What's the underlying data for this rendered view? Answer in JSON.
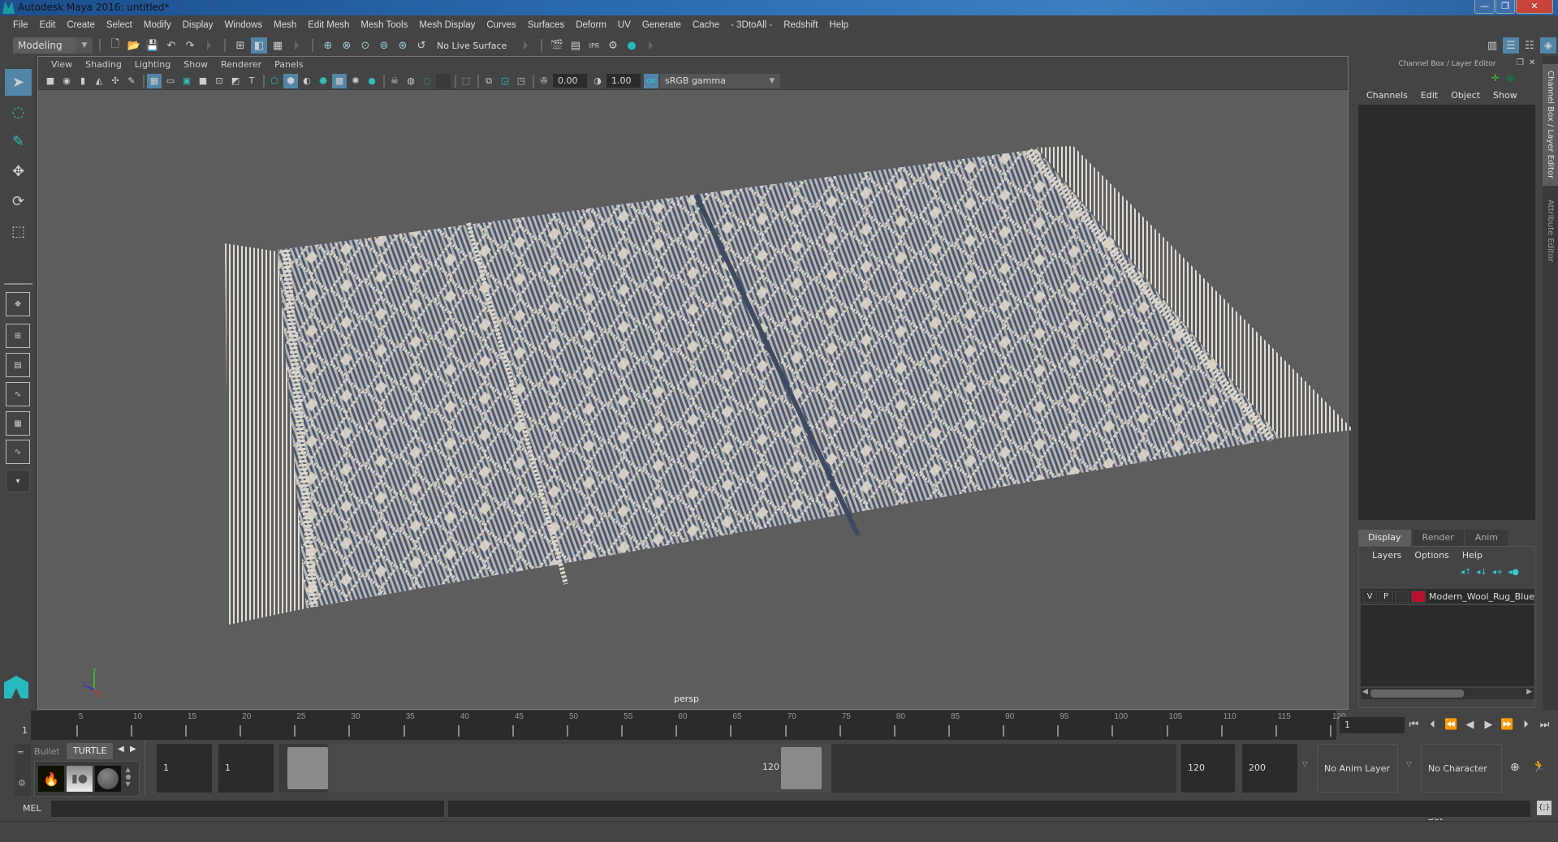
{
  "window": {
    "title": "Autodesk Maya 2016: untitled*",
    "controls": {
      "minimize": "—",
      "restore": "❐",
      "close": "✕"
    }
  },
  "menubar": [
    "File",
    "Edit",
    "Create",
    "Select",
    "Modify",
    "Display",
    "Windows",
    "Mesh",
    "Edit Mesh",
    "Mesh Tools",
    "Mesh Display",
    "Curves",
    "Surfaces",
    "Deform",
    "UV",
    "Generate",
    "Cache",
    "- 3DtoAll -",
    "Redshift",
    "Help"
  ],
  "statusline": {
    "menuset": "Modeling",
    "live_surface": "No Live Surface",
    "icons": [
      "new-scene-icon",
      "open-scene-icon",
      "save-scene-icon",
      "undo-icon",
      "redo-icon",
      "select-by-hierarchy-icon",
      "select-by-object-icon",
      "select-by-component-icon",
      "snap-grid-icon",
      "snap-curve-icon",
      "snap-point-icon",
      "snap-view-plane-icon",
      "snap-live-icon",
      "render-view-icon",
      "render-icon",
      "ipr-render-icon",
      "render-settings-icon",
      "hypershade-icon"
    ],
    "ipr_label": "IPR"
  },
  "viewport": {
    "menus": [
      "View",
      "Shading",
      "Lighting",
      "Show",
      "Renderer",
      "Panels"
    ],
    "exposure": "0.00",
    "gamma": "1.00",
    "color_mgmt_toggle": "ON",
    "view_transform": "sRGB gamma",
    "camera_label": "persp",
    "axis": {
      "x": "x",
      "y": "y",
      "z": "z"
    },
    "rug_colors": {
      "base": "#4a5870",
      "pattern": "#d9d2c6",
      "fringe": "#e2ddd4"
    }
  },
  "toolbox": {
    "tools": [
      "select-tool",
      "lasso-tool",
      "paint-select-tool",
      "move-tool",
      "rotate-tool",
      "scale-tool"
    ],
    "layouts": [
      "single-perspective-layout",
      "four-view-layout",
      "persp-outliner-layout",
      "persp-graph-layout",
      "persp-hypershade-layout",
      "persp-graph-outliner-layout"
    ],
    "more": "▾"
  },
  "right_panel": {
    "header": "Channel Box / Layer Editor",
    "channel_menus": [
      "Channels",
      "Edit",
      "Object",
      "Show"
    ],
    "layer_tabs": [
      "Display",
      "Render",
      "Anim"
    ],
    "active_layer_tab": "Display",
    "layer_menus": [
      "Layers",
      "Options",
      "Help"
    ],
    "layers": [
      {
        "visible": "V",
        "playback": "P",
        "name": "Modern_Wool_Rug_Blue",
        "color": "#b4122e"
      }
    ],
    "side_tabs": [
      "Channel Box / Layer Editor",
      "Attribute Editor"
    ]
  },
  "timeline": {
    "start": 1,
    "end": 120,
    "tick_labels": [
      "5",
      "10",
      "15",
      "20",
      "25",
      "30",
      "35",
      "40",
      "45",
      "50",
      "55",
      "60",
      "65",
      "70",
      "75",
      "80",
      "85",
      "90",
      "95",
      "100",
      "105",
      "110",
      "115",
      "120"
    ],
    "current_frame_marker": "1",
    "current_frame": "1",
    "playback_buttons": [
      "go-to-start",
      "step-back-frame",
      "step-back-key",
      "play-backwards",
      "play-forwards",
      "step-forward-key",
      "step-forward-frame",
      "go-to-end"
    ]
  },
  "shelf": {
    "tabs": [
      "Bullet",
      "TURTLE"
    ],
    "active_tab": "TURTLE"
  },
  "range": {
    "anim_start": "1",
    "playback_start": "1",
    "slider_start_label": "1",
    "slider_end_label": "120",
    "playback_end": "120",
    "anim_end": "200",
    "anim_layer": "No Anim Layer",
    "character_set": "No Character Set"
  },
  "command_line": {
    "language": "MEL",
    "input": "",
    "result": ""
  }
}
